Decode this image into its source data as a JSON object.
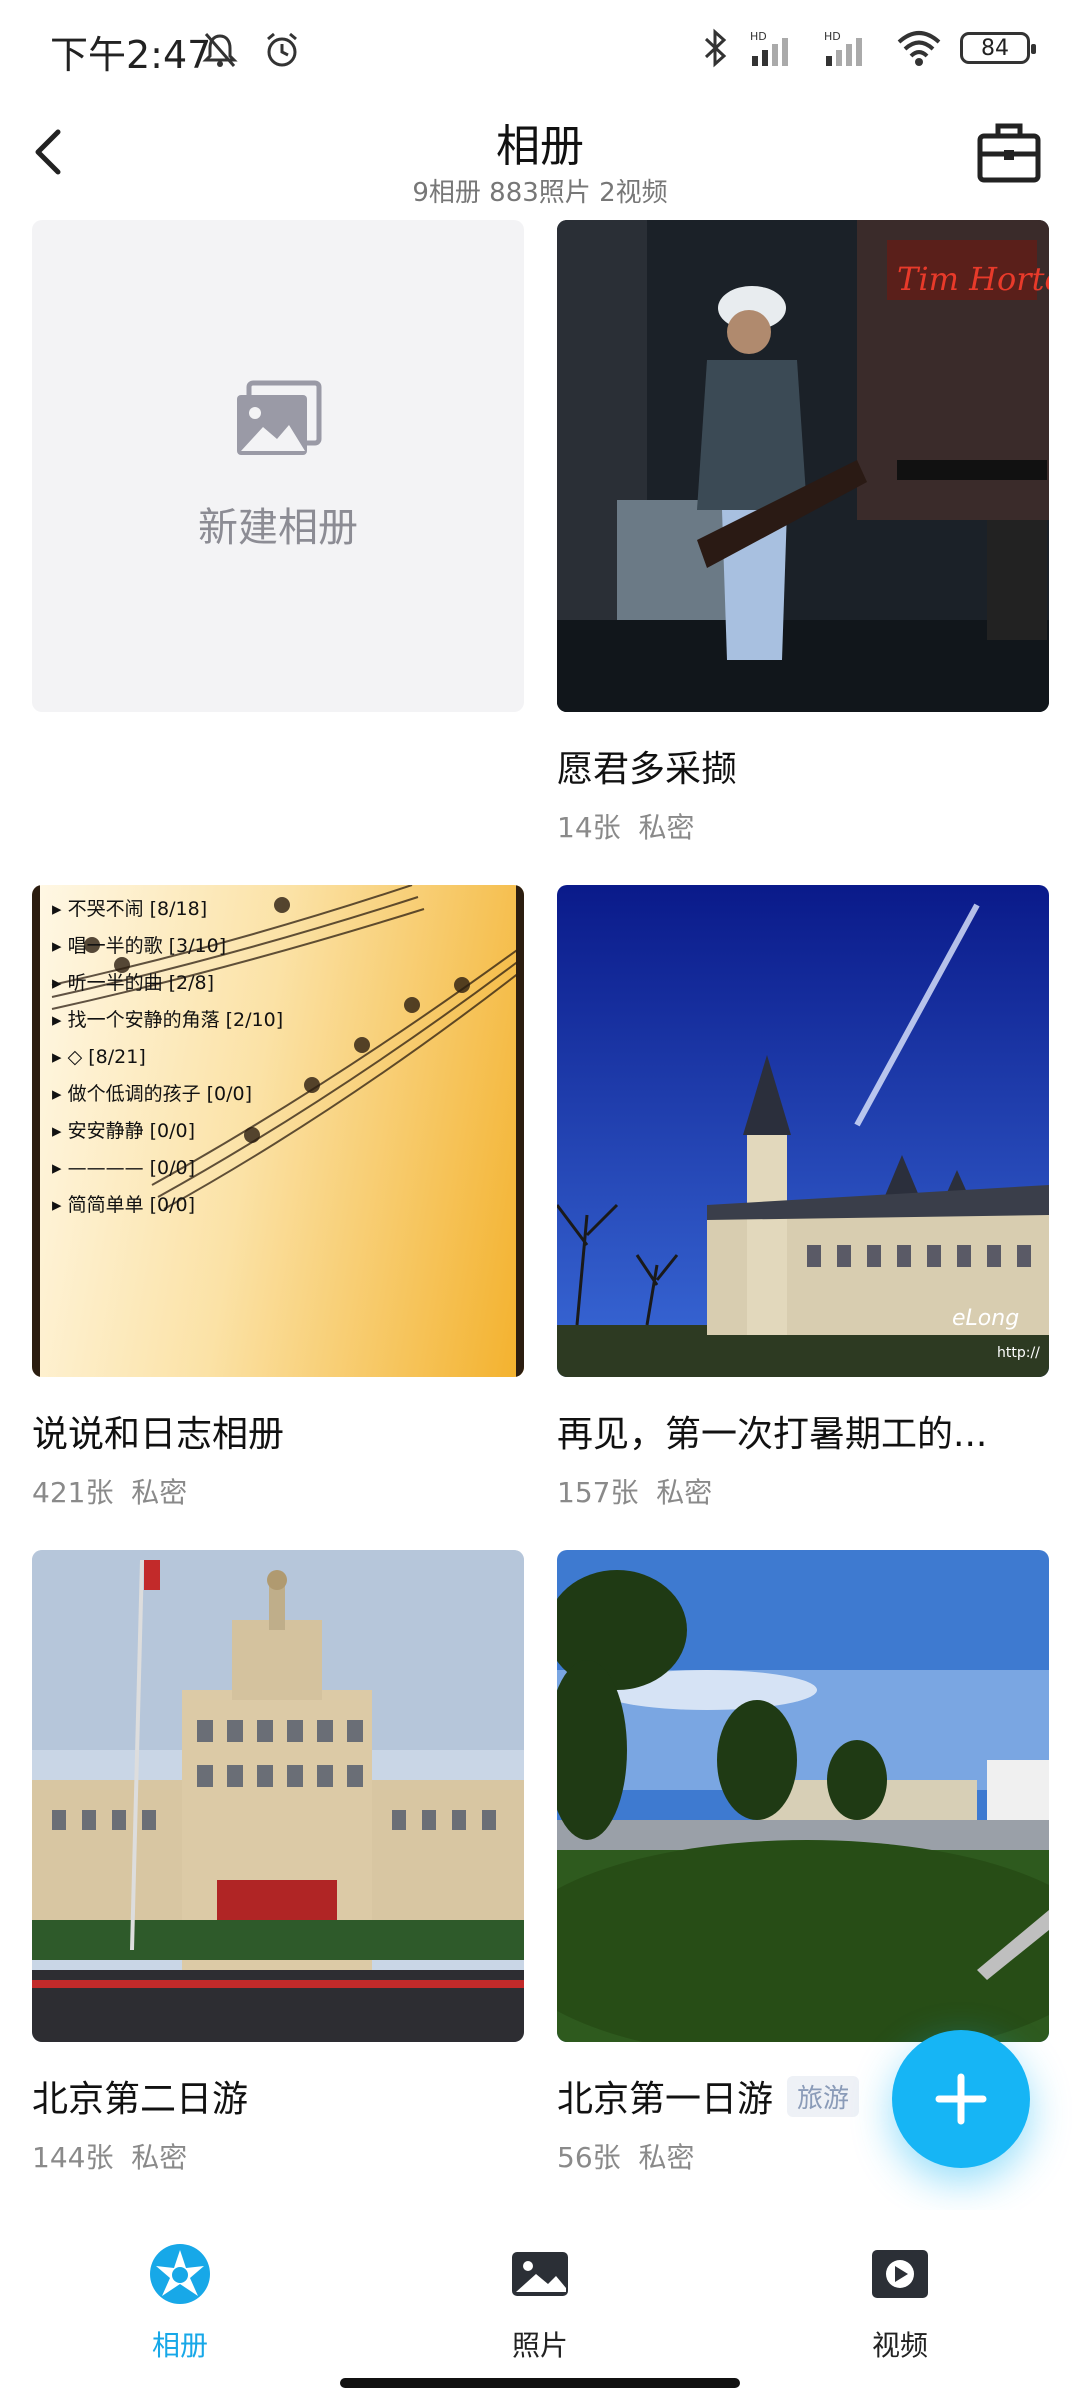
{
  "status_bar": {
    "time": "下午2:47",
    "battery": "84"
  },
  "header": {
    "title": "相册",
    "subtitle": "9相册  883照片  2视频"
  },
  "albums": [
    {
      "type": "new",
      "label": "新建相册"
    },
    {
      "name": "愿君多采撷",
      "count": "14张",
      "privacy": "私密"
    },
    {
      "name": "说说和日志相册",
      "count": "421张",
      "privacy": "私密"
    },
    {
      "name": "再见，第一次打暑期工的...",
      "count": "157张",
      "privacy": "私密"
    },
    {
      "name": "北京第二日游",
      "count": "144张",
      "privacy": "私密"
    },
    {
      "name": "北京第一日游",
      "tag": "旅游",
      "count": "56张",
      "privacy": "私密"
    }
  ],
  "songlist": [
    {
      "title": "不哭不闹",
      "count": "[8/18]"
    },
    {
      "title": "唱一半的歌",
      "count": "[3/10]"
    },
    {
      "title": "听一半的曲",
      "count": "[2/8]"
    },
    {
      "title": "找一个安静的角落",
      "count": "[2/10]"
    },
    {
      "title": "◇",
      "count": "[8/21]"
    },
    {
      "title": "做个低调的孩子",
      "count": "[0/0]"
    },
    {
      "title": "安安静静",
      "count": "[0/0]"
    },
    {
      "title": "————",
      "count": "[0/0]"
    },
    {
      "title": "简简单单",
      "count": "[0/0]"
    }
  ],
  "photo_text": {
    "store_sign": "Tim Hortons",
    "watermark": "eLong",
    "watermark_url": "http://"
  },
  "bottom_nav": [
    {
      "label": "相册",
      "icon": "album-icon",
      "active": true
    },
    {
      "label": "照片",
      "icon": "photo-icon",
      "active": false
    },
    {
      "label": "视频",
      "icon": "video-icon",
      "active": false
    }
  ],
  "colors": {
    "accent": "#17a8e8",
    "fab": "#16b5f5"
  }
}
